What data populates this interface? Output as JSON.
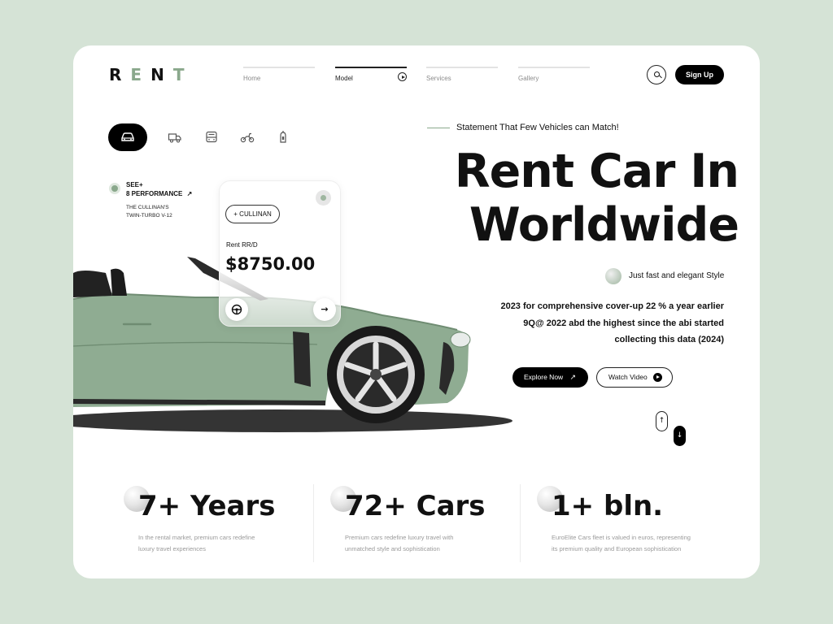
{
  "brand": {
    "letters": [
      "R",
      "E",
      "N",
      "T"
    ]
  },
  "nav": {
    "items": [
      "Home",
      "Model",
      "Services",
      "Gallery"
    ],
    "active": "Model"
  },
  "header": {
    "signup_label": "Sign Up"
  },
  "performance": {
    "title_line1": "SEE+",
    "title_line2": "8 PERFORMANCE",
    "arrow": "↗",
    "sub_line1": "THE CULLINAN'S",
    "sub_line2": "TWIN-TURBO V-12"
  },
  "rent_card": {
    "pill": "+ CULLINAN",
    "label": "Rent RR/D",
    "price": "$8750.00",
    "next_arrow": "→"
  },
  "hero": {
    "tagline": "Statement That Few Vehicles can Match!",
    "title_line1": "Rent Car In",
    "title_line2": "Worldwide",
    "style_text": "Just fast and elegant Style",
    "desc_line1": "2023 for comprehensive cover-up 22 % a year earlier",
    "desc_line2": "9Q@ 2022 abd the highest since the abi started",
    "desc_line3": "collecting this data (2024)",
    "explore_label": "Explore Now",
    "explore_arrow": "↗",
    "watch_label": "Watch Video"
  },
  "scroll": {
    "up": "↑",
    "down": "↓"
  },
  "stats": [
    {
      "value": "7+ Years",
      "caption_line1": "In the rental market, premium cars redefine",
      "caption_line2": "luxury travel experiences"
    },
    {
      "value": "72+ Cars",
      "caption_line1": "Premium cars redefine luxury travel with",
      "caption_line2": "unmatched style and sophistication"
    },
    {
      "value": "1+ bln.",
      "caption_line1": "EuroElite Cars fleet is valued in euros, representing",
      "caption_line2": "its premium quality and European sophistication"
    }
  ],
  "colors": {
    "background": "#d5e3d6",
    "accent": "#8aa88c",
    "car": "#8fac92",
    "dark": "#000000"
  },
  "icons": [
    "search-icon",
    "car-icon",
    "truck-icon",
    "bus-icon",
    "motorbike-icon",
    "scooter-icon",
    "steering-icon",
    "arrow-right-icon",
    "play-icon"
  ]
}
